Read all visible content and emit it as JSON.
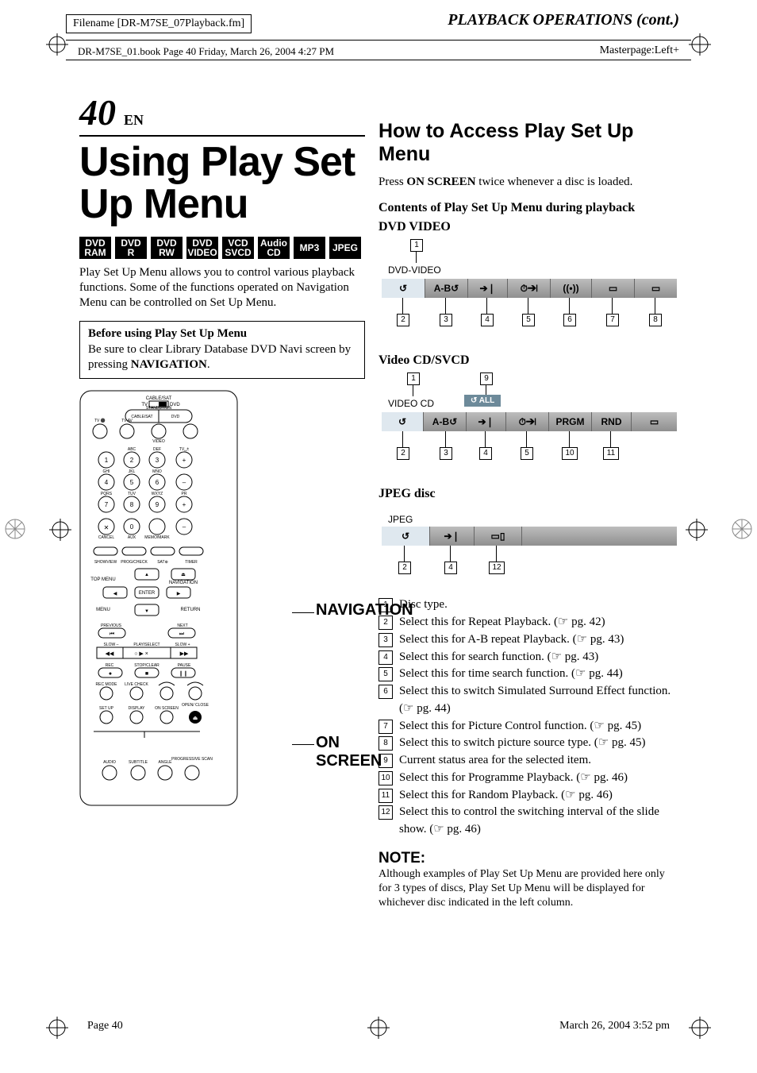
{
  "meta": {
    "filename_box": "Filename [DR-M7SE_07Playback.fm]",
    "book_info": "DR-M7SE_01.book  Page 40  Friday, March 26, 2004  4:27 PM",
    "masterpage": "Masterpage:Left+",
    "page_footer_left": "Page 40",
    "page_footer_right": "March 26, 2004  3:52 pm"
  },
  "left": {
    "page_number": "40",
    "lang": "EN",
    "section_title": "PLAYBACK OPERATIONS (cont.)",
    "big_title": "Using Play Set Up Menu",
    "formats": [
      {
        "l1": "DVD",
        "l2": "RAM"
      },
      {
        "l1": "DVD",
        "l2": "R"
      },
      {
        "l1": "DVD",
        "l2": "RW"
      },
      {
        "l1": "DVD",
        "l2": "VIDEO"
      },
      {
        "l1": "VCD",
        "l2": "SVCD"
      },
      {
        "l1": "Audio",
        "l2": "CD"
      },
      {
        "l1": "MP3",
        "l2": ""
      },
      {
        "l1": "JPEG",
        "l2": ""
      }
    ],
    "intro": "Play Set Up Menu allows you to control various playback functions. Some of the functions operated on Navigation Menu can be controlled on Set Up Menu.",
    "note_box": {
      "hdr": "Before using Play Set Up Menu",
      "body_pre": "Be sure to clear Library Database DVD Navi screen by pressing ",
      "body_key": "NAVIGATION",
      "body_post": "."
    },
    "labels": {
      "navigation": "NAVIGATION",
      "on_screen": "ON SCREEN"
    }
  },
  "right": {
    "howto": "How to Access Play Set Up Menu",
    "press_pre": "Press ",
    "press_key": "ON SCREEN",
    "press_post": " twice whenever a disc is loaded.",
    "contents_hdr": "Contents of Play Set Up Menu during playback",
    "dvd_video": {
      "title": "DVD VIDEO",
      "mg_title": "DVD-VIDEO",
      "callouts_top": [
        "1"
      ],
      "cells": [
        "↺",
        "A-B↺",
        "➔❘",
        "⏱➔❘",
        "((•))",
        "▭",
        "▭"
      ],
      "callouts_bottom": [
        "2",
        "3",
        "4",
        "5",
        "6",
        "7",
        "8"
      ]
    },
    "vcd": {
      "title": "Video CD/SVCD",
      "mg_title": "VIDEO CD",
      "status": "↺  ALL",
      "callouts_top": [
        "1",
        "9"
      ],
      "cells": [
        "↺",
        "A-B↺",
        "➔❘",
        "⏱➔❘",
        "PRGM",
        "RND",
        "▭"
      ],
      "callouts_bottom": [
        "2",
        "3",
        "4",
        "5",
        "10",
        "11"
      ]
    },
    "jpeg": {
      "title": "JPEG disc",
      "mg_title": "JPEG",
      "cells": [
        "↺",
        "➔❘",
        "▭▯"
      ],
      "callouts_bottom": [
        "2",
        "4",
        "12"
      ]
    },
    "legend": [
      {
        "n": "1",
        "t": "Disc type."
      },
      {
        "n": "2",
        "t": "Select this for Repeat Playback. (☞ pg. 42)"
      },
      {
        "n": "3",
        "t": "Select this for A-B repeat Playback. (☞ pg. 43)"
      },
      {
        "n": "4",
        "t": "Select this for search function. (☞ pg. 43)"
      },
      {
        "n": "5",
        "t": "Select this for time search function. (☞ pg. 44)"
      },
      {
        "n": "6",
        "t": "Select this to switch Simulated Surround Effect function. (☞ pg. 44)"
      },
      {
        "n": "7",
        "t": "Select this for Picture Control function. (☞ pg. 45)"
      },
      {
        "n": "8",
        "t": "Select this to switch picture source type. (☞ pg. 45)"
      },
      {
        "n": "9",
        "t": "Current status area for the selected item."
      },
      {
        "n": "10",
        "t": "Select this for Programme Playback. (☞ pg. 46)"
      },
      {
        "n": "11",
        "t": "Select this for Random Playback. (☞ pg. 46)"
      },
      {
        "n": "12",
        "t": "Select this to control the switching interval of the slide show. (☞ pg. 46)"
      }
    ],
    "note": {
      "hdr": "NOTE:",
      "body": "Although examples of Play Set Up Menu are provided here only for 3 types of discs, Play Set Up Menu will be displayed for whichever disc indicated in the left column."
    }
  },
  "remote_labels": {
    "row_top": [
      "CABLE/SAT",
      "TV",
      "DVD"
    ],
    "standby": "STANDBY/ON",
    "tv_vol": "TV ⚫",
    "tv_av": "TV AV",
    "cablesat": "CABLE/SAT",
    "dvd": "DVD",
    "video": "VIDEO",
    "abc": "ABC",
    "def": "DEF",
    "tvch": "TV␣±",
    "ghi": "GHI",
    "jkl": "JKL",
    "mno": "MNO",
    "pqrs": "PQRS",
    "tuv": "TUV",
    "wxyz": "WXYZ",
    "pr": "PR",
    "cancel": "CANCEL",
    "aux": "AUX",
    "memo": "MEMO/MARK",
    "showview": "SHOWVIEW",
    "progcheck": "PROG/CHECK",
    "satdl": "SAT⊕",
    "timer": "TIMER",
    "topmenu": "TOP MENU",
    "navigation": "NAVIGATION",
    "enter": "ENTER",
    "menu": "MENU",
    "return": "RETURN",
    "previous": "PREVIOUS",
    "next": "NEXT",
    "slowm": "SLOW –",
    "playselect": "PLAY/SELECT",
    "slowp": "SLOW +",
    "rec": "REC",
    "stopclear": "STOP/CLEAR",
    "pause": "PAUSE",
    "recmode": "REC MODE",
    "livecheck": "LIVE CHECK",
    "setup": "SET UP",
    "display": "DISPLAY",
    "onscreen": "ON SCREEN",
    "openclose": "OPEN/\nCLOSE",
    "audio": "AUDIO",
    "subtitle": "SUBTITLE",
    "angle": "ANGLE",
    "progscan": "PROGRESSIVE\nSCAN"
  }
}
